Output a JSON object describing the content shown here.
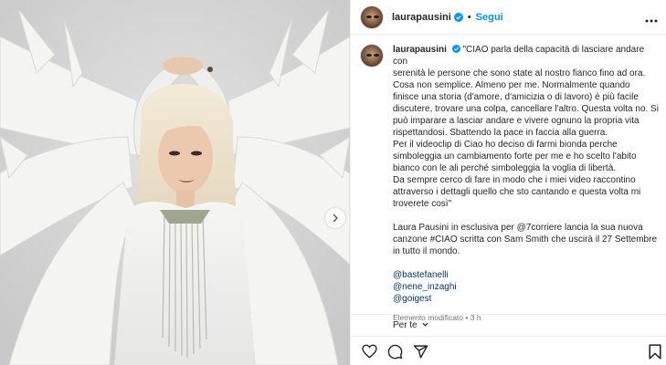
{
  "post": {
    "username": "laurapausini",
    "follow_label": "Segui",
    "separator": "•"
  },
  "caption": {
    "lines": [
      "\"CIAO parla della capacità di lasciare andare con",
      "serenità le persone che sono state al nostro fianco fino ad ora.",
      "Cosa non semplice. Almeno per me. Normalmente quando",
      "finisce una storia (d'amore, d'amicizia o di lavoro) è più facile",
      "discutere, trovare una colpa, cancellare l'altro. Questa volta no. Si",
      "può imparare a lasciar andare e vivere ognuno la propria vita",
      "rispettandosi. Sbattendo la pace in faccia alla guerra.",
      "Per il videoclip di Ciao ho deciso di farmi bionda perche",
      "simboleggia un cambiamento forte per me e ho scelto l'abito",
      "bianco con le ali perché simboleggia la voglia di libertà.",
      "Da sempre cerco di fare in modo che i miei video raccontino",
      "attraverso i dettagli quello che sto cantando e questa volta mi",
      "troverete così\""
    ],
    "lines2": [
      "Laura Pausini in esclusiva per @7corriere lancia la sua nuova",
      "canzone #CIAO scritta con Sam Smith che uscirà il 27 Settembre",
      "in tutto il mondo."
    ],
    "tags": [
      "@bastefanelli",
      "@nene_inzaghi",
      "@goigest"
    ],
    "edited_label": "Elemento modificato",
    "time": "3 h"
  },
  "footer": {
    "per_te_label": "Per te"
  },
  "icons": {
    "verified": "verified-badge-icon",
    "more": "more-horizontal-icon",
    "like": "heart-icon",
    "comment": "comment-icon",
    "share": "send-icon",
    "save": "bookmark-icon",
    "carousel": "chevron-right-icon"
  },
  "colors": {
    "link": "#0095f6",
    "mention": "#00376b",
    "muted": "#737373",
    "text": "#262626"
  }
}
